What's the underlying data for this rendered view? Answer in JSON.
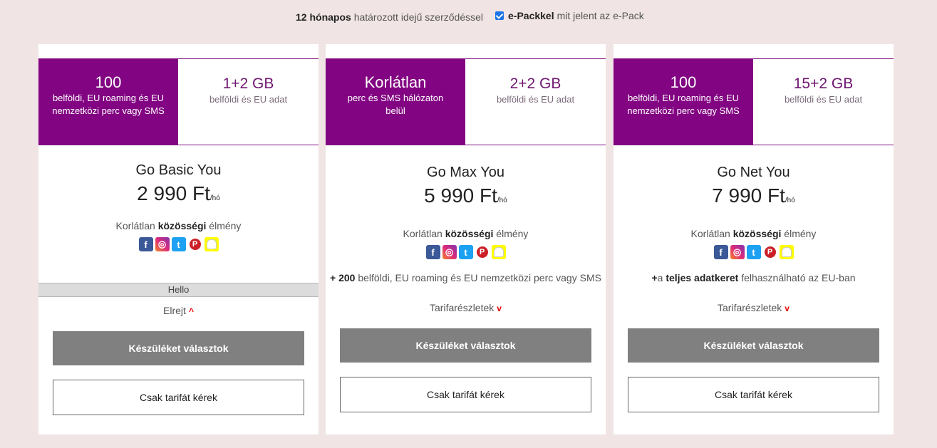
{
  "topbar": {
    "contract_bold": "12 hónapos",
    "contract_rest": "határozott idejű szerződéssel",
    "epack_checked": true,
    "epack_bold": "e-Packkel",
    "epack_link": "mit jelent az e-Pack"
  },
  "colors": {
    "brand": "#820482",
    "accent": "#e60000",
    "button_gray": "#808080"
  },
  "social_icons": [
    "facebook-icon",
    "instagram-icon",
    "twitter-icon",
    "pinterest-icon",
    "snapchat-icon"
  ],
  "plans": [
    {
      "header_left_big": "100",
      "header_left_small": "belföldi, EU roaming és EU nemzetközi perc vagy SMS",
      "header_right_big": "1+2 GB",
      "header_right_small": "belföldi és EU adat",
      "name": "Go Basic You",
      "price": "2 990 Ft",
      "price_unit": "/hó",
      "social_pre": "Korlátlan",
      "social_bold": "közösségi",
      "social_post": "élmény",
      "hello": "Hello",
      "toggle": "Elrejt",
      "btn_primary": "Készüléket választok",
      "btn_secondary": "Csak tarifát kérek"
    },
    {
      "header_left_big": "Korlátlan",
      "header_left_small": "perc és SMS hálózaton belül",
      "header_right_big": "2+2 GB",
      "header_right_small": "belföldi és EU adat",
      "name": "Go Max You",
      "price": "5 990 Ft",
      "price_unit": "/hó",
      "social_pre": "Korlátlan",
      "social_bold": "közösségi",
      "social_post": "élmény",
      "extra_bold": "+ 200",
      "extra_rest": "belföldi, EU roaming és EU nemzetközi perc vagy SMS",
      "toggle": "Tarifarészletek",
      "btn_primary": "Készüléket választok",
      "btn_secondary": "Csak tarifát kérek"
    },
    {
      "header_left_big": "100",
      "header_left_small": "belföldi, EU roaming és EU nemzetközi perc vagy SMS",
      "header_right_big": "15+2 GB",
      "header_right_small": "belföldi és EU adat",
      "name": "Go Net You",
      "price": "7 990 Ft",
      "price_unit": "/hó",
      "social_pre": "Korlátlan",
      "social_bold": "közösségi",
      "social_post": "élmény",
      "extra_bold1": "+",
      "extra_mid": "a",
      "extra_bold2": "teljes adatkeret",
      "extra_rest": "felhasználható az EU-ban",
      "toggle": "Tarifarészletek",
      "btn_primary": "Készüléket választok",
      "btn_secondary": "Csak tarifát kérek"
    }
  ]
}
